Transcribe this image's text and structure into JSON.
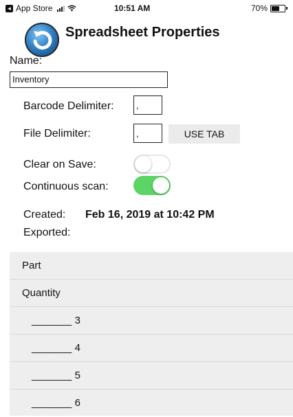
{
  "status_bar": {
    "back_app": "App Store",
    "time": "10:51 AM",
    "battery": "70%",
    "battery_level": 0.7
  },
  "header": {
    "app_icon": "refresh-logo-icon",
    "title": "Spreadsheet Properties"
  },
  "form": {
    "name_label": "Name:",
    "name_value": "Inventory",
    "barcode_delimiter_label": "Barcode Delimiter:",
    "barcode_delimiter_value": ",",
    "file_delimiter_label": "File Delimiter:",
    "file_delimiter_value": ",",
    "use_tab_label": "USE TAB",
    "clear_on_save_label": "Clear on Save:",
    "clear_on_save_on": false,
    "continuous_scan_label": "Continuous scan:",
    "continuous_scan_on": true,
    "created_label": "Created:",
    "created_value": "Feb 16, 2019 at 10:42 PM",
    "exported_label": "Exported:"
  },
  "columns": [
    {
      "label": "Part"
    },
    {
      "label": "Quantity"
    },
    {
      "label": "_______ 3"
    },
    {
      "label": "_______ 4"
    },
    {
      "label": "_______ 5"
    },
    {
      "label": "_______ 6"
    }
  ],
  "colors": {
    "toggle_on": "#5dd566",
    "list_background": "#efeeee",
    "button_background": "#ebebeb"
  }
}
